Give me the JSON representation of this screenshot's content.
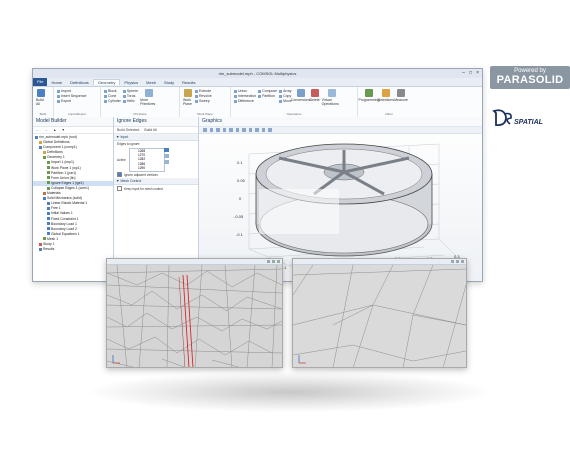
{
  "window": {
    "title": "rim_submodel.mph - COMSOL Multiphysics",
    "menu": [
      "File",
      "Home",
      "Definitions",
      "Geometry",
      "Physics",
      "Mesh",
      "Study",
      "Results"
    ],
    "active_menu": "Geometry"
  },
  "ribbon": {
    "build_all": "Build All",
    "import": "Import",
    "insert_sequence": "Insert Sequence",
    "export": "Export",
    "block": "Block",
    "cone": "Cone",
    "cylinder": "Cylinder",
    "sphere": "Sphere",
    "torus": "Torus",
    "helix": "Helix",
    "more_primitives": "More Primitives",
    "work_plane": "Work Plane",
    "extrude": "Extrude",
    "revolve": "Revolve",
    "sweep": "Sweep",
    "union": "Union",
    "intersection": "Intersection",
    "difference": "Difference",
    "compose": "Compose",
    "partition": "Partition",
    "array": "Array",
    "copy": "Copy",
    "move": "Move",
    "conversions": "Conversions",
    "delete": "Delete",
    "virtual_operations": "Virtual Operations",
    "programming": "Programming",
    "selections": "Selections",
    "measure": "Measure",
    "groups": [
      "Build",
      "Import/Export",
      "Primitives",
      "Work Plane",
      "Operations",
      "Other"
    ]
  },
  "model_builder": {
    "title": "Model Builder",
    "tree": [
      {
        "label": "rim_submodel.mph (root)",
        "indent": 0,
        "color": "#5b7fb5"
      },
      {
        "label": "Global Definitions",
        "indent": 1,
        "color": "#d9a441"
      },
      {
        "label": "Component 1 (comp1)",
        "indent": 1,
        "color": "#5b7fb5"
      },
      {
        "label": "Definitions",
        "indent": 2,
        "color": "#d9a441"
      },
      {
        "label": "Geometry 1",
        "indent": 2,
        "color": "#6a9a4d"
      },
      {
        "label": "Import 1 (imp1)",
        "indent": 3,
        "color": "#6a9a4d"
      },
      {
        "label": "Work Plane 1 (wp1)",
        "indent": 3,
        "color": "#6a9a4d"
      },
      {
        "label": "Partition 1 (par1)",
        "indent": 3,
        "color": "#6a9a4d"
      },
      {
        "label": "Form Union (fin)",
        "indent": 3,
        "color": "#6a9a4d"
      },
      {
        "label": "Ignore Edges 1 (ige1)",
        "indent": 3,
        "color": "#6a9a4d",
        "selected": true
      },
      {
        "label": "Collapse Edges 1 (cme1)",
        "indent": 3,
        "color": "#6a9a4d"
      },
      {
        "label": "Materials",
        "indent": 2,
        "color": "#b07a4a"
      },
      {
        "label": "Solid Mechanics (solid)",
        "indent": 2,
        "color": "#4a7fc1"
      },
      {
        "label": "Linear Elastic Material 1",
        "indent": 3,
        "color": "#4a7fc1"
      },
      {
        "label": "Free 1",
        "indent": 3,
        "color": "#4a7fc1"
      },
      {
        "label": "Initial Values 1",
        "indent": 3,
        "color": "#4a7fc1"
      },
      {
        "label": "Fixed Constraint 1",
        "indent": 3,
        "color": "#4a7fc1"
      },
      {
        "label": "Boundary Load 1",
        "indent": 3,
        "color": "#4a7fc1"
      },
      {
        "label": "Boundary Load 2",
        "indent": 3,
        "color": "#4a7fc1"
      },
      {
        "label": "Global Equations 1",
        "indent": 3,
        "color": "#4a7fc1"
      },
      {
        "label": "Mesh 1",
        "indent": 2,
        "color": "#6a9a4d"
      },
      {
        "label": "Study 1",
        "indent": 1,
        "color": "#c75b5b"
      },
      {
        "label": "Results",
        "indent": 1,
        "color": "#5b7fb5"
      }
    ]
  },
  "settings": {
    "title": "Ignore Edges",
    "build_selected": "Build Selected",
    "build_all": "Build All",
    "input_section": "Input",
    "edges_label": "Edges to ignore:",
    "edges": [
      "1268",
      "1270",
      "1282",
      "1286",
      "1290",
      "1292"
    ],
    "active_label": "Active",
    "ignore_vertices": "Ignore adjacent vertices",
    "mesh_section": "Mesh Control",
    "keep_input": "Keep input for mesh control"
  },
  "graphics": {
    "title": "Graphics",
    "z_ticks": [
      "0.1",
      "0.05",
      "0",
      "-0.05",
      "-0.1"
    ],
    "x_ticks": [
      "0.2",
      "0.1",
      "0"
    ],
    "y_ticks": [
      "0.1",
      "0.2",
      "0.3"
    ],
    "axis_x": "x",
    "axis_y": "y",
    "axis_z": "z"
  },
  "logos": {
    "powered_by": "Powered by",
    "parasolid": "PARASOLID",
    "spatial": "SPATIAL"
  },
  "colors": {
    "accent": "#2b5797",
    "parasolid_box": "#8b96a3",
    "crack_line": "#d42a2a",
    "mesh_fill": "#d8d8d8"
  }
}
